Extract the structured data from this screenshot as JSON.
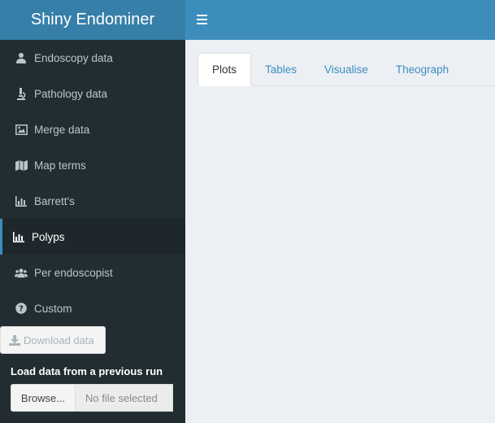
{
  "app": {
    "title": "Shiny Endominer"
  },
  "sidebar": {
    "items": [
      {
        "label": "Endoscopy data",
        "icon": "user-doctor-icon",
        "active": false
      },
      {
        "label": "Pathology data",
        "icon": "microscope-icon",
        "active": false
      },
      {
        "label": "Merge data",
        "icon": "image-merge-icon",
        "active": false
      },
      {
        "label": "Map terms",
        "icon": "map-icon",
        "active": false
      },
      {
        "label": "Barrett's",
        "icon": "bar-chart-icon",
        "active": false
      },
      {
        "label": "Polyps",
        "icon": "bar-chart-icon",
        "active": true
      },
      {
        "label": "Per endoscopist",
        "icon": "users-icon",
        "active": false
      },
      {
        "label": "Custom",
        "icon": "question-circle-icon",
        "active": false
      }
    ],
    "download_label": "Download data",
    "load_label": "Load data from a previous run",
    "browse_label": "Browse...",
    "file_placeholder": "No file selected"
  },
  "tabs": [
    {
      "label": "Plots",
      "active": true
    },
    {
      "label": "Tables",
      "active": false
    },
    {
      "label": "Visualise",
      "active": false
    },
    {
      "label": "Theograph",
      "active": false
    }
  ],
  "colors": {
    "header": "#3c8dbc",
    "logo": "#367fa9",
    "sidebar": "#222d32",
    "sidebar_active": "#1e282c",
    "content_bg": "#ecf0f5"
  }
}
